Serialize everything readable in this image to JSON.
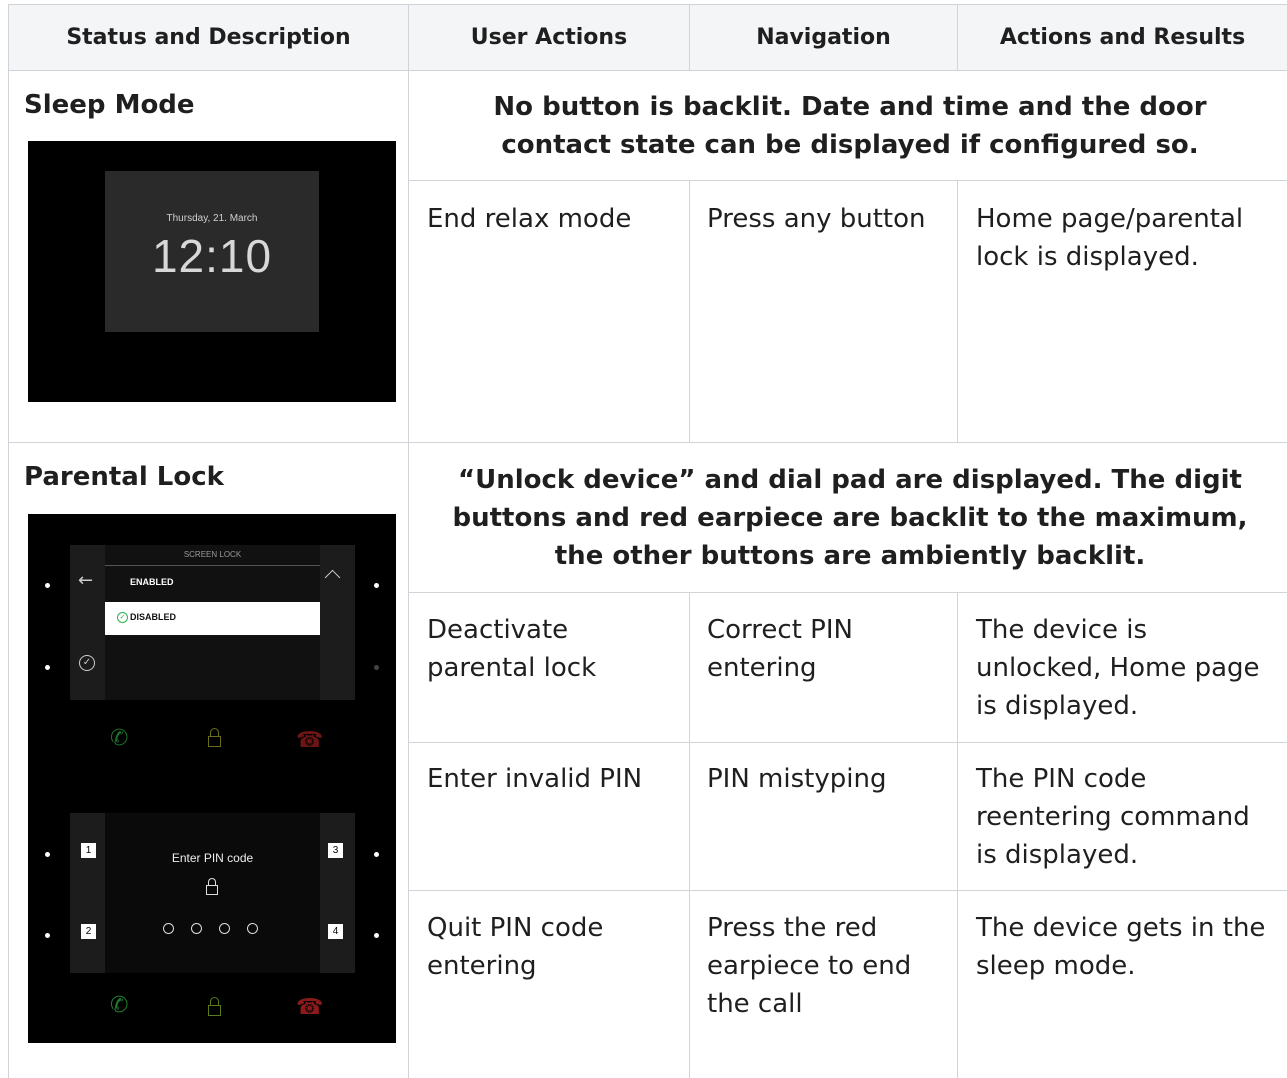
{
  "table": {
    "headers": [
      "Status and Description",
      "User Actions",
      "Navigation",
      "Actions and Results"
    ]
  },
  "sleep_mode": {
    "title": "Sleep Mode",
    "description": "No button is backlit. Date and time and the door contact state can be displayed if configured so.",
    "screen": {
      "date": "Thursday, 21. March",
      "time": "12:10"
    },
    "rows": [
      {
        "action": "End relax mode",
        "navigation": "Press any button",
        "result": "Home page/parental lock is displayed."
      }
    ]
  },
  "parental_lock": {
    "title": "Parental Lock",
    "description": "“Unlock device” and dial pad are displayed. The digit buttons and red earpiece are backlit to the maximum, the other buttons are ambiently backlit.",
    "screen1": {
      "header": "SCREEN LOCK",
      "option_enabled": "ENABLED",
      "option_disabled": "DISABLED"
    },
    "screen2": {
      "prompt": "Enter PIN code",
      "keys": [
        "1",
        "2",
        "3",
        "4"
      ]
    },
    "rows": [
      {
        "action": "Deactivate parental lock",
        "navigation": "Correct PIN entering",
        "result": "The device is unlocked, Home page is displayed."
      },
      {
        "action": "Enter invalid PIN",
        "navigation": "PIN mistyping",
        "result": "The PIN code reentering command is displayed."
      },
      {
        "action": "Quit PIN code entering",
        "navigation": "Press the red earpiece to end the call",
        "result": "The device gets in the sleep mode."
      }
    ]
  },
  "colors": {
    "header_bg": "#f4f5f7",
    "grid": "#d0d3d8",
    "green": "#1f7a2e",
    "red": "#8b1a1a",
    "ok_green": "#2bb24c"
  }
}
